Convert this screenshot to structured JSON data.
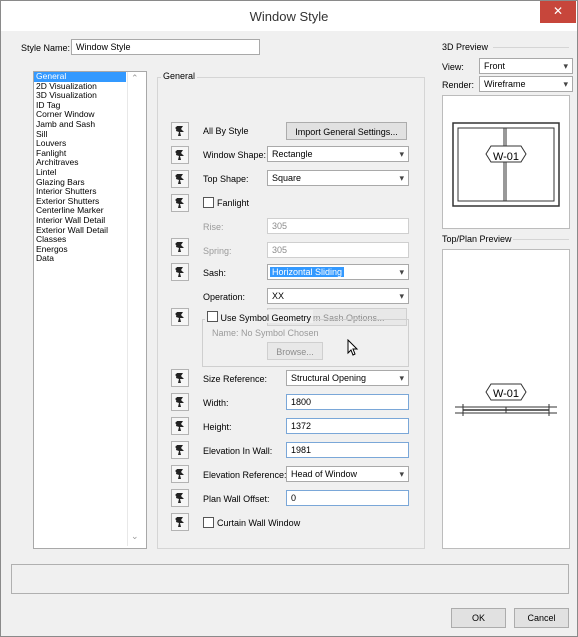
{
  "window": {
    "title": "Window Style",
    "close_glyph": "✕"
  },
  "style_name": {
    "label": "Style Name:",
    "value": "Window Style"
  },
  "sidebar": {
    "items": [
      "General",
      "2D Visualization",
      "3D Visualization",
      "ID Tag",
      "Corner Window",
      "Jamb and Sash",
      "Sill",
      "Louvers",
      "Fanlight",
      "Architraves",
      "Lintel",
      "Glazing Bars",
      "Interior Shutters",
      "Exterior Shutters",
      "Centerline Marker",
      "Interior Wall Detail",
      "Exterior Wall Detail",
      "Classes",
      "Energos",
      "Data"
    ],
    "selected": "General",
    "scroll_up": "⌃",
    "scroll_down": "⌄"
  },
  "general": {
    "group_label": "General",
    "all_by_style": "All By Style",
    "import_button": "Import General Settings...",
    "window_shape": {
      "label": "Window Shape:",
      "value": "Rectangle"
    },
    "top_shape": {
      "label": "Top Shape:",
      "value": "Square"
    },
    "fanlight": {
      "label": "Fanlight"
    },
    "rise": {
      "label": "Rise:",
      "value": "305"
    },
    "spring": {
      "label": "Spring:",
      "value": "305"
    },
    "sash": {
      "label": "Sash:",
      "value": "Horizontal Sliding"
    },
    "operation": {
      "label": "Operation:",
      "value": "XX"
    },
    "custom_sash_button": "Custom Sash Options...",
    "use_symbol_geometry": "Use Symbol Geometry",
    "symbol_name": "Name:  No Symbol Chosen",
    "browse_button": "Browse...",
    "size_reference": {
      "label": "Size Reference:",
      "value": "Structural Opening"
    },
    "width": {
      "label": "Width:",
      "value": "1800"
    },
    "height": {
      "label": "Height:",
      "value": "1372"
    },
    "elevation_in_wall": {
      "label": "Elevation In Wall:",
      "value": "1981"
    },
    "elevation_reference": {
      "label": "Elevation Reference:",
      "value": "Head of Window"
    },
    "plan_wall_offset": {
      "label": "Plan Wall Offset:",
      "value": "0"
    },
    "curtain_wall_window": "Curtain Wall Window"
  },
  "preview3d": {
    "section_label": "3D Preview",
    "view": {
      "label": "View:",
      "value": "Front"
    },
    "render": {
      "label": "Render:",
      "value": "Wireframe"
    },
    "tag": "W-01"
  },
  "plan_preview": {
    "section_label": "Top/Plan Preview",
    "tag": "W-01"
  },
  "footer": {
    "ok": "OK",
    "cancel": "Cancel"
  },
  "icons": {
    "by_style": "by-style-toggle-icon",
    "caret": "▾"
  }
}
